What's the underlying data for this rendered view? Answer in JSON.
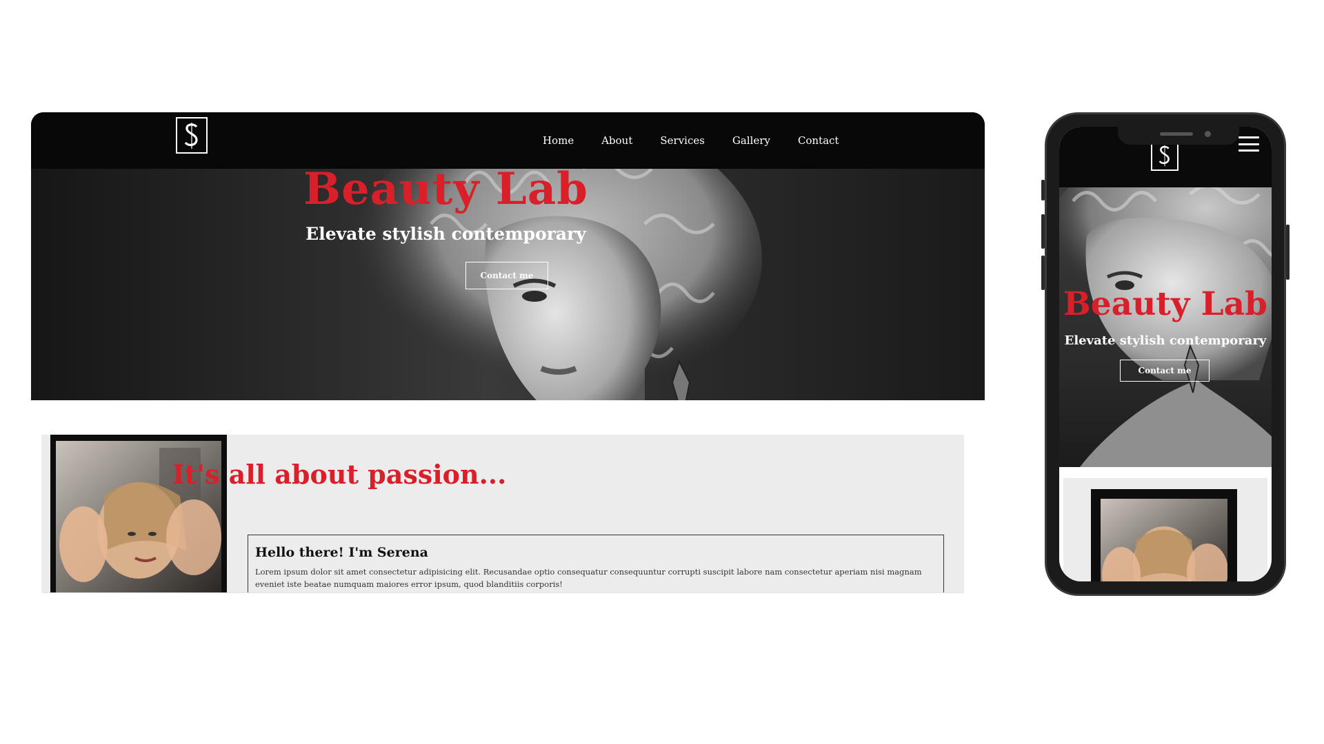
{
  "desktop": {
    "nav": {
      "logo_text": "S",
      "items": [
        {
          "label": "Home"
        },
        {
          "label": "About"
        },
        {
          "label": "Services"
        },
        {
          "label": "Gallery"
        },
        {
          "label": "Contact"
        }
      ]
    },
    "hero": {
      "title": "Beauty Lab",
      "subtitle": "Elevate stylish contemporary",
      "cta_label": "Contact me"
    },
    "about": {
      "heading": "It's all about passion...",
      "card_title": "Hello there! I'm Serena",
      "card_body": "Lorem ipsum dolor sit amet consectetur adipisicing elit. Recusandae optio consequatur consequuntur corrupti suscipit labore nam consectetur aperiam nisi magnam eveniet iste beatae numquam maiores error ipsum, quod blanditiis corporis!"
    }
  },
  "mobile": {
    "logo_text": "S",
    "hero": {
      "title": "Beauty Lab",
      "subtitle": "Elevate stylish contemporary",
      "cta_label": "Contact me"
    }
  },
  "colors": {
    "accent_red": "#d81f2a",
    "nav_bg": "#080808",
    "section_bg": "#ececec"
  }
}
